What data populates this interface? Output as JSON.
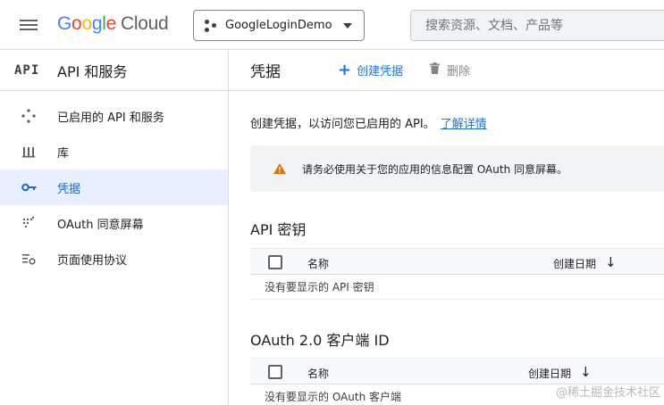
{
  "header": {
    "logo_letters": [
      "G",
      "o",
      "o",
      "g",
      "l",
      "e"
    ],
    "logo_product": "Cloud",
    "project_name": "GoogleLoginDemo",
    "search_placeholder": "搜索资源、文档、产品等"
  },
  "sidebar": {
    "badge": "API",
    "title": "API 和服务",
    "items": [
      {
        "label": "已启用的 API 和服务",
        "icon": "enabled-apis-icon",
        "active": false
      },
      {
        "label": "库",
        "icon": "library-icon",
        "active": false
      },
      {
        "label": "凭据",
        "icon": "key-icon",
        "active": true
      },
      {
        "label": "OAuth 同意屏幕",
        "icon": "oauth-consent-icon",
        "active": false
      },
      {
        "label": "页面使用协议",
        "icon": "page-usage-icon",
        "active": false
      }
    ]
  },
  "main": {
    "title": "凭据",
    "create_label": "创建凭据",
    "delete_label": "删除",
    "intro_text": "创建凭据，以访问您已启用的 API。",
    "learn_more": "了解详情",
    "notice_text": "请务必使用关于您的应用的信息配置 OAuth 同意屏幕。",
    "api_keys": {
      "title": "API 密钥",
      "col_name": "名称",
      "col_date": "创建日期",
      "empty": "没有要显示的 API 密钥"
    },
    "oauth_clients": {
      "title": "OAuth 2.0 客户端 ID",
      "col_name": "名称",
      "col_date": "创建日期",
      "empty": "没有要显示的 OAuth 客户端"
    }
  },
  "watermark": "@稀土掘金技术社区",
  "colors": {
    "accent": "#1a73e8",
    "active_bg": "#e8f0fe",
    "warning": "#e37400"
  }
}
